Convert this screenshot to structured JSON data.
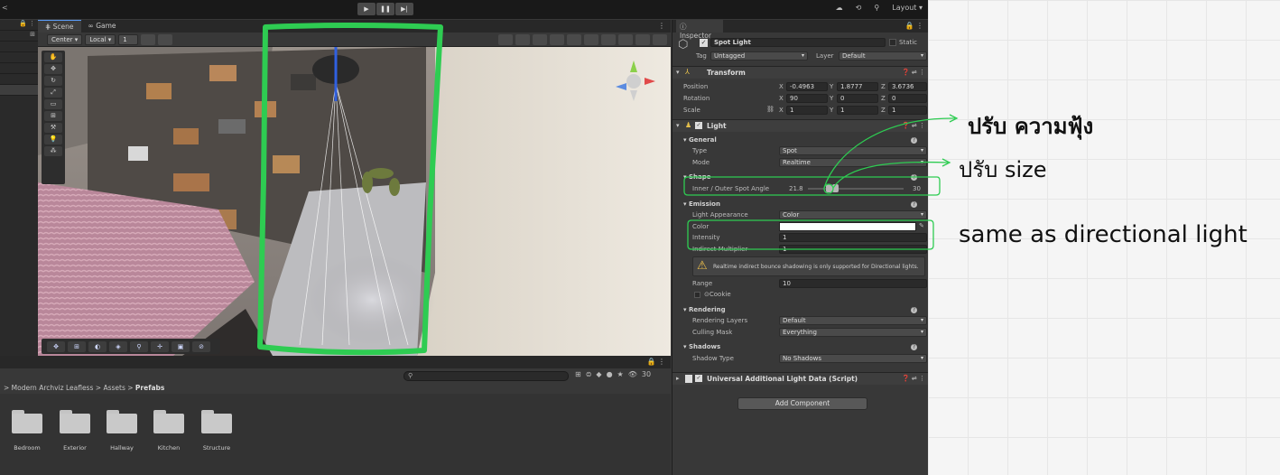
{
  "toolbar": {
    "layout_label": "Layout"
  },
  "scene_tabs": [
    {
      "label": "Scene"
    },
    {
      "label": "Game"
    }
  ],
  "scene_toolbar": {
    "pivot": "Center",
    "space": "Local",
    "grid_value": "1"
  },
  "project": {
    "breadcrumb": [
      "Modern Archviz Leafless",
      "Assets",
      "Prefabs"
    ],
    "count": "30",
    "folders": [
      "Bedroom",
      "Exterior",
      "Hallway",
      "Kitchen",
      "Structure"
    ]
  },
  "inspector": {
    "tab_label": "Inspector",
    "object_name": "Spot Light",
    "static_label": "Static",
    "tag_label": "Tag",
    "tag_value": "Untagged",
    "layer_label": "Layer",
    "layer_value": "Default",
    "transform": {
      "title": "Transform",
      "position_label": "Position",
      "rotation_label": "Rotation",
      "scale_label": "Scale",
      "position": {
        "x": "-0.4963",
        "y": "1.8777",
        "z": "3.6736"
      },
      "rotation": {
        "x": "90",
        "y": "0",
        "z": "0"
      },
      "scale": {
        "x": "1",
        "y": "1",
        "z": "1"
      }
    },
    "light": {
      "title": "Light",
      "general": "General",
      "type_label": "Type",
      "type_value": "Spot",
      "mode_label": "Mode",
      "mode_value": "Realtime",
      "shape": "Shape",
      "spot_angle_label": "Inner / Outer Spot Angle",
      "inner_angle": "21.8",
      "outer_angle": "30",
      "emission": "Emission",
      "appearance_label": "Light Appearance",
      "appearance_value": "Color",
      "color_label": "Color",
      "intensity_label": "Intensity",
      "intensity_value": "1",
      "indirect_label": "Indirect Multiplier",
      "indirect_value": "1",
      "warning": "Realtime indirect bounce shadowing is only supported for Directional lights.",
      "range_label": "Range",
      "range_value": "10",
      "cookie_label": "Cookie",
      "rendering": "Rendering",
      "rendering_layers_label": "Rendering Layers",
      "rendering_layers_value": "Default",
      "culling_label": "Culling Mask",
      "culling_value": "Everything",
      "shadows": "Shadows",
      "shadow_type_label": "Shadow Type",
      "shadow_type_value": "No Shadows"
    },
    "script_component": "Universal Additional Light Data (Script)",
    "add_component": "Add Component"
  },
  "annotations": {
    "softness": "ปรับ ความฟุ้ง",
    "size": "ปรับ size",
    "same": "same as directional light"
  },
  "colors": {
    "highlight_green": "#2ecc52",
    "light_color": "#ffffff",
    "accent": "#5a9cf8"
  }
}
